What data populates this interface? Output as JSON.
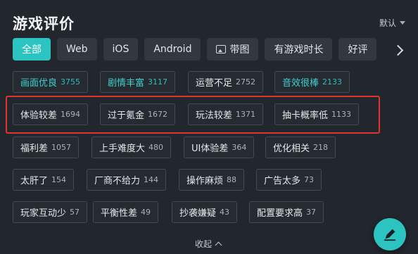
{
  "header": {
    "title": "游戏评价",
    "sort_label": "默认"
  },
  "tabs": [
    {
      "label": "全部",
      "active": true
    },
    {
      "label": "Web"
    },
    {
      "label": "iOS"
    },
    {
      "label": "Android"
    },
    {
      "label": "带图",
      "icon": "image-icon"
    },
    {
      "label": "有游戏时长"
    },
    {
      "label": "好评"
    }
  ],
  "tags": [
    {
      "label": "画面优良",
      "count": "3755",
      "highlight": true
    },
    {
      "label": "剧情丰富",
      "count": "3117",
      "highlight": true
    },
    {
      "label": "运营不足",
      "count": "2752"
    },
    {
      "label": "音效很棒",
      "count": "2133",
      "highlight": true
    },
    {
      "label": "体验较差",
      "count": "1694"
    },
    {
      "label": "过于氪金",
      "count": "1672"
    },
    {
      "label": "玩法较差",
      "count": "1371"
    },
    {
      "label": "抽卡概率低",
      "count": "1133"
    },
    {
      "label": "福利差",
      "count": "1057"
    },
    {
      "label": "上手难度大",
      "count": "480"
    },
    {
      "label": "UI体验差",
      "count": "364"
    },
    {
      "label": "优化相关",
      "count": "218"
    },
    {
      "label": "太肝了",
      "count": "154"
    },
    {
      "label": "厂商不给力",
      "count": "144"
    },
    {
      "label": "操作麻烦",
      "count": "88"
    },
    {
      "label": "广告太多",
      "count": "73"
    },
    {
      "label": "玩家互动少",
      "count": "57"
    },
    {
      "label": "平衡性差",
      "count": "49"
    },
    {
      "label": "抄袭嫌疑",
      "count": "43"
    },
    {
      "label": "配置要求高",
      "count": "37"
    }
  ],
  "footer": {
    "collapse_label": "收起"
  },
  "colors": {
    "accent": "#2bc4c0",
    "annotation": "#e0322f",
    "background": "#22262d"
  }
}
